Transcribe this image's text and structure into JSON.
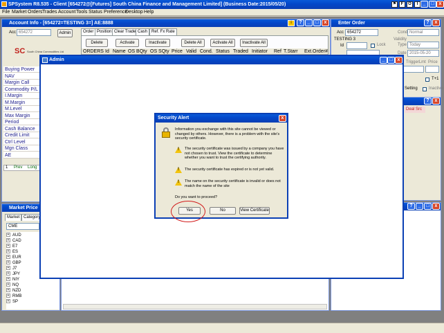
{
  "app": {
    "title": "SPSystem R8.535 - Client [654272@[Futures] South China Finance and Management Limited] (Business Date:2015/05/20)",
    "menu": [
      "File",
      "Market",
      "Orders",
      "Trades",
      "Account",
      "Tools",
      "Status",
      "Preference",
      "Desktop",
      "Help"
    ],
    "toolbar_letters": [
      "F",
      "O",
      "I"
    ]
  },
  "account_info": {
    "title": "Account Info - [654272=TESTING 3=] AE:8888",
    "acc_label": "Acc",
    "acc_value": "654272",
    "admin_button": "Admin",
    "logo_text": "South China Commodities Ltd",
    "items": [
      "Buying Power",
      "NAV",
      "Margin Call",
      "Commodity P/L",
      "I.Margin",
      "M.Margin",
      "M.Level",
      "Max Margin",
      "Period",
      "Cash Balance",
      "Credit Limit",
      "Ctrl Level",
      "Mgn Class",
      "AE"
    ],
    "prev_label": "Prev",
    "long_label": "Long",
    "row_marker": "1"
  },
  "order_tabs": {
    "tabs": [
      "Order",
      "Position",
      "Clear Trade",
      "Cash",
      "Ref. Fx Rate"
    ],
    "buttons": [
      "Delete",
      "Activate",
      "Inactivate",
      "Delete All",
      "Activate All",
      "Inactivate All"
    ],
    "columns": [
      "ORDERS",
      "Id",
      "Name",
      "OS BQty",
      "OS SQty",
      "Price",
      "Valid",
      "Cond.",
      "Status",
      "Traded",
      "Initiator",
      "Ref",
      "T.Starr",
      "Ext.Order#"
    ]
  },
  "enter_order": {
    "title": "Enter Order",
    "acc_label": "Acc",
    "acc_value": "654272",
    "acc_name": "TESTING 3",
    "id_label": "Id",
    "lock_label": "Lock",
    "cond_label": "Cond",
    "cond_value": "Normal",
    "validity_label": "Validity",
    "type_label": "Type",
    "type_value": "Today",
    "date_label": "Date",
    "date_value": "2015-05-20",
    "trigger_label": "TriggerLmt",
    "price_label": "Price",
    "tplus1_label": "T+1",
    "setting_label": "Setting",
    "inactive_label": "Inactive",
    "deal_src_label": "Deal Src"
  },
  "market_price": {
    "title": "Market Price",
    "tabs": [
      "Market",
      "Category"
    ],
    "exchange": "CME",
    "items": [
      "AUD",
      "CAD",
      "E7",
      "ES",
      "EUR",
      "GBP",
      "J7",
      "JPY",
      "NIY",
      "NQ",
      "NZD",
      "RMB",
      "SP"
    ]
  },
  "admin_window": {
    "title": "Admin"
  },
  "security_alert": {
    "title": "Security Alert",
    "intro": "Information you exchange with this site cannot be viewed or changed by others. However, there is a problem with the site's security certificate.",
    "warnings": [
      "The security certificate was issued by a company you have not chosen to trust. View the certificate to determine whether you want to trust the certifying authority.",
      "The security certificate has expired or is not yet valid.",
      "The name on the security certificate is invalid or does not match the name of the site"
    ],
    "question": "Do you want to proceed?",
    "yes_button": "Yes",
    "no_button": "No",
    "view_cert_button": "View Certificate"
  }
}
